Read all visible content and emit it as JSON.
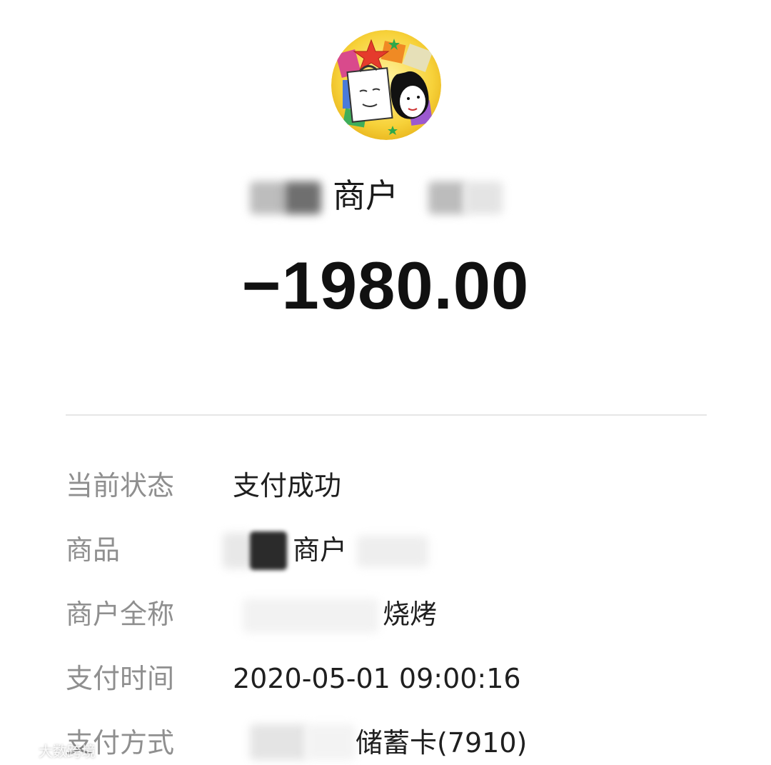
{
  "merchant": {
    "name": "商户"
  },
  "amount": "−1980.00",
  "details": {
    "status": {
      "label": "当前状态",
      "value": "支付成功"
    },
    "product": {
      "label": "商品",
      "value": "商户"
    },
    "merchant_full_name": {
      "label": "商户全称",
      "value": "烧烤"
    },
    "pay_time": {
      "label": "支付时间",
      "value": "2020-05-01 09:00:16"
    },
    "pay_method": {
      "label": "支付方式",
      "value": "储蓄卡(7910)"
    }
  },
  "watermark": {
    "text": "大数跨境"
  },
  "colors": {
    "background": "#ffffff",
    "label": "#8f8f8f",
    "value": "#1f1f1f",
    "amount": "#111111",
    "divider": "#e6e6e6"
  },
  "icons": {
    "avatar": "merchant-avatar-cartoon",
    "watermark": "brand-logo-icon"
  }
}
